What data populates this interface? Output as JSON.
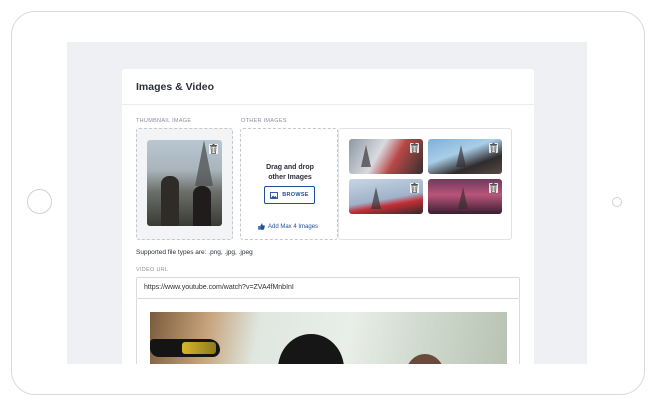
{
  "section": {
    "title": "Images & Video"
  },
  "thumbnail": {
    "label": "THUMBNAIL IMAGE"
  },
  "other_images": {
    "label": "OTHER IMAGES",
    "drop_text_line1": "Drag and drop",
    "drop_text_line2": "other Images",
    "browse_label": "BROWSE",
    "add_max_label": "Add Max 4 Images"
  },
  "supported_types": "Supported file types are: .png, .jpg, .jpeg",
  "video": {
    "label": "VIDEO URL",
    "url_value": "https://www.youtube.com/watch?v=ZVA4fMnbInI"
  },
  "icons": {
    "trash": "trash-icon",
    "image": "image-icon",
    "thumbs_up": "thumbs-up-icon"
  },
  "colors": {
    "accent": "#1d4f9c",
    "text": "#2b2f38",
    "muted": "#8a8f99",
    "background": "#eef0f3"
  }
}
